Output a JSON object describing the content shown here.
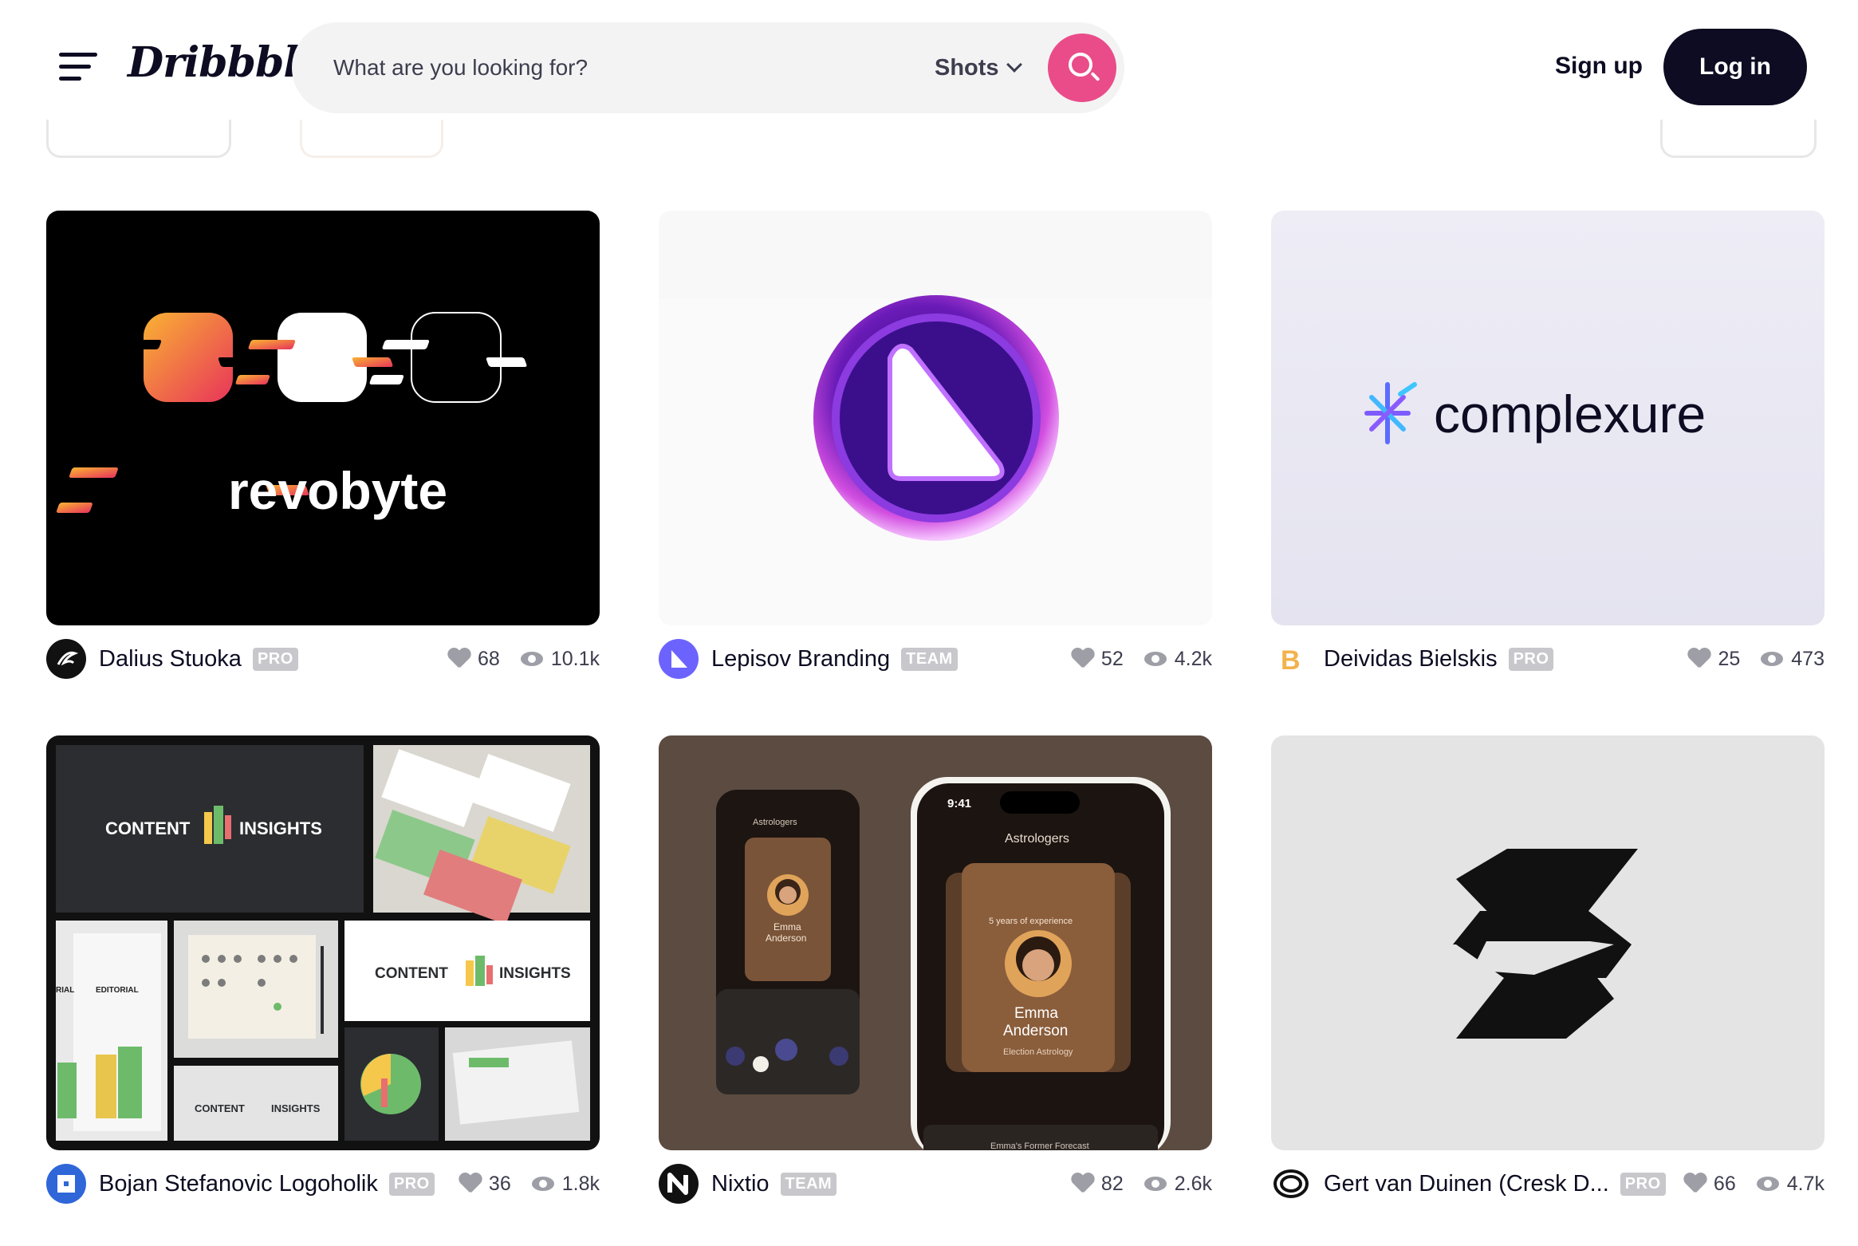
{
  "header": {
    "logo": "Dribbble",
    "search_placeholder": "What are you looking for?",
    "search_scope": "Shots",
    "signup_label": "Sign up",
    "login_label": "Log in"
  },
  "colors": {
    "brand_pink": "#ea4c89",
    "dark": "#0d0c22",
    "badge_gray": "#c7c7cc"
  },
  "shots": [
    {
      "author": "Dalius Stuoka",
      "badge": "PRO",
      "likes": "68",
      "views": "10.1k",
      "wordmark": "revobyte"
    },
    {
      "author": "Lepisov Branding",
      "badge": "TEAM",
      "likes": "52",
      "views": "4.2k"
    },
    {
      "author": "Deividas Bielskis",
      "badge": "PRO",
      "likes": "25",
      "views": "473",
      "wordmark": "complexure"
    },
    {
      "author": "Bojan Stefanovic Logoholik",
      "badge": "PRO",
      "likes": "36",
      "views": "1.8k",
      "content_word": "CONTENT",
      "insights_word": "INSIGHTS",
      "mini_label_1": "EDITORIAL",
      "mini_label_2": "RIAL"
    },
    {
      "author": "Nixtio",
      "badge": "TEAM",
      "likes": "82",
      "views": "2.6k",
      "phone": {
        "time": "9:41",
        "title": "Astrologers",
        "experience": "5 years of experience",
        "name_line1": "Emma",
        "name_line2": "Anderson",
        "specialty": "Election Astrology",
        "forecast": "Emma's Former Forecast"
      }
    },
    {
      "author": "Gert van Duinen (Cresk D...",
      "badge": "PRO",
      "likes": "66",
      "views": "4.7k"
    }
  ]
}
